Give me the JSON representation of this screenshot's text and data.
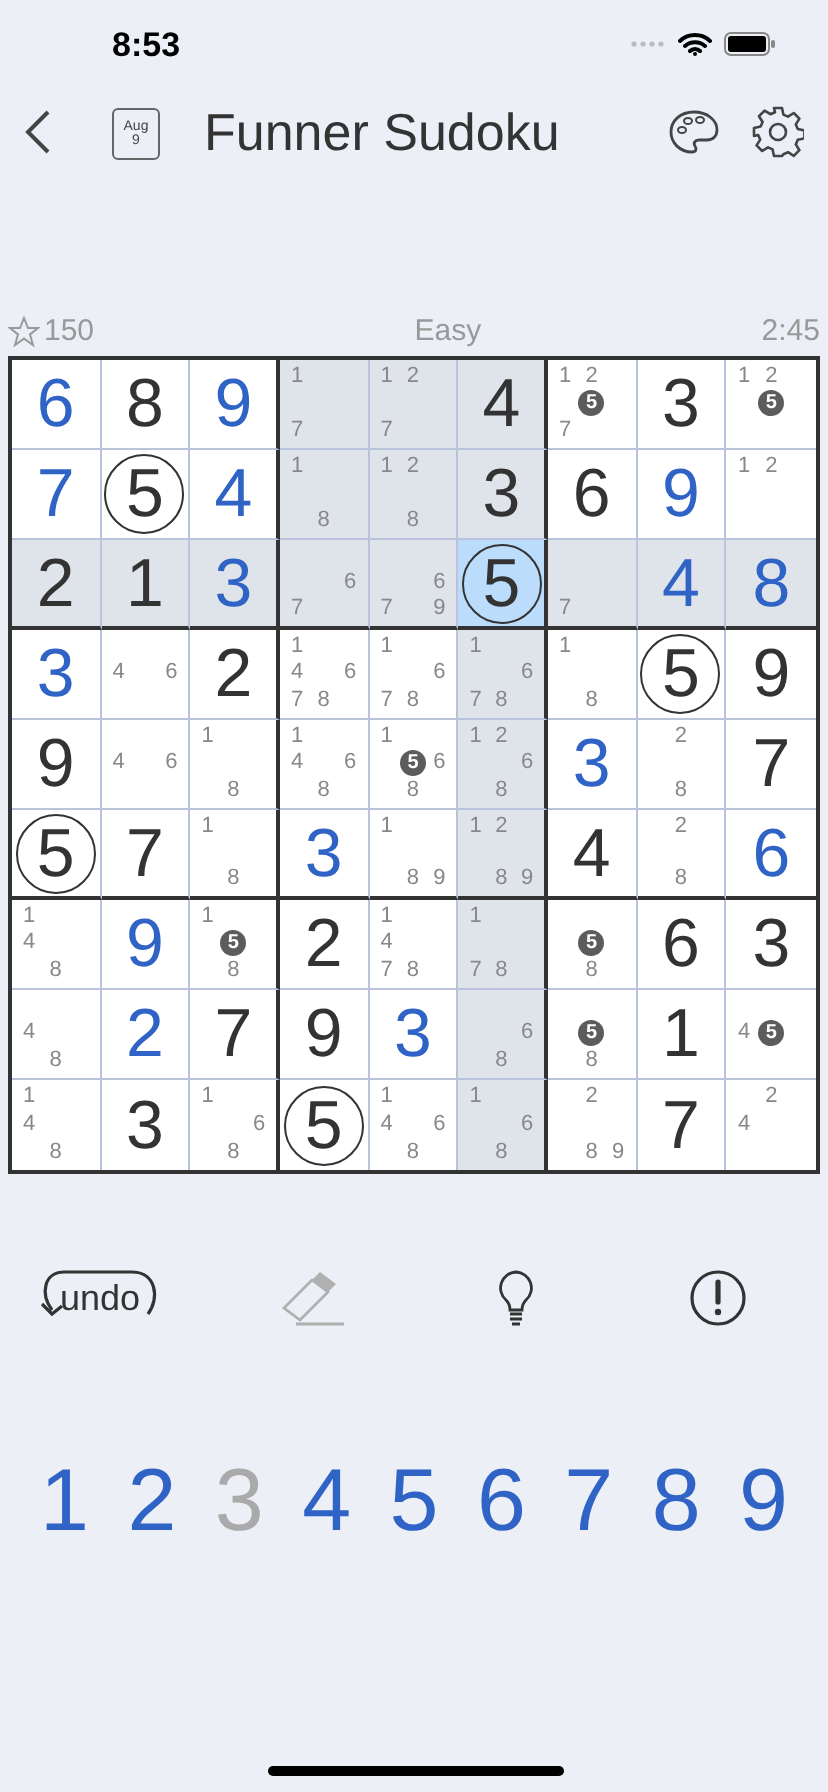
{
  "status_bar": {
    "time": "8:53"
  },
  "nav": {
    "title": "Funner Sudoku",
    "calendar": {
      "month": "Aug",
      "day": "9"
    }
  },
  "info": {
    "stars": "150",
    "difficulty": "Easy",
    "timer": "2:45"
  },
  "grid": [
    [
      {
        "kind": "entered",
        "value": "6",
        "circled": false,
        "highlighted": false,
        "selected": false
      },
      {
        "kind": "given",
        "value": "8",
        "circled": false,
        "highlighted": false,
        "selected": false
      },
      {
        "kind": "entered",
        "value": "9",
        "circled": false,
        "highlighted": false,
        "selected": false
      },
      {
        "kind": "notes",
        "highlighted": true,
        "selected": false,
        "notes": [
          {
            "digit": "1",
            "kind": "topleft",
            "marked": false
          },
          {
            "digit": "7",
            "kind": "bottomleft",
            "marked": false
          }
        ]
      },
      {
        "kind": "notes",
        "highlighted": true,
        "selected": false,
        "notes": [
          {
            "digit": "1",
            "kind": "topleft",
            "marked": false
          },
          {
            "digit": "2",
            "kind": "top",
            "marked": false
          },
          {
            "digit": "7",
            "kind": "bottomleft",
            "marked": false
          }
        ]
      },
      {
        "kind": "given",
        "value": "4",
        "circled": false,
        "highlighted": true,
        "selected": false
      },
      {
        "kind": "notes",
        "highlighted": false,
        "selected": false,
        "notes": [
          {
            "digit": "1",
            "kind": "topleft",
            "marked": false
          },
          {
            "digit": "2",
            "kind": "top",
            "marked": false
          },
          {
            "digit": "5",
            "kind": "center",
            "marked": true
          },
          {
            "digit": "7",
            "kind": "bottomleft",
            "marked": false
          }
        ]
      },
      {
        "kind": "given",
        "value": "3",
        "circled": false,
        "highlighted": false,
        "selected": false
      },
      {
        "kind": "notes",
        "highlighted": false,
        "selected": false,
        "notes": [
          {
            "digit": "1",
            "kind": "topleft",
            "marked": false
          },
          {
            "digit": "2",
            "kind": "top",
            "marked": false
          },
          {
            "digit": "5",
            "kind": "center",
            "marked": true
          }
        ]
      }
    ],
    [
      {
        "kind": "entered",
        "value": "7",
        "circled": false,
        "highlighted": false,
        "selected": false
      },
      {
        "kind": "given",
        "value": "5",
        "circled": true,
        "highlighted": false,
        "selected": false
      },
      {
        "kind": "entered",
        "value": "4",
        "circled": false,
        "highlighted": false,
        "selected": false
      },
      {
        "kind": "notes",
        "highlighted": true,
        "selected": false,
        "notes": [
          {
            "digit": "1",
            "kind": "topleft",
            "marked": false
          },
          {
            "digit": "8",
            "kind": "bottom",
            "marked": false
          }
        ]
      },
      {
        "kind": "notes",
        "highlighted": true,
        "selected": false,
        "notes": [
          {
            "digit": "1",
            "kind": "topleft",
            "marked": false
          },
          {
            "digit": "2",
            "kind": "top",
            "marked": false
          },
          {
            "digit": "8",
            "kind": "bottom",
            "marked": false
          }
        ]
      },
      {
        "kind": "given",
        "value": "3",
        "circled": false,
        "highlighted": true,
        "selected": false
      },
      {
        "kind": "given",
        "value": "6",
        "circled": false,
        "highlighted": false,
        "selected": false
      },
      {
        "kind": "entered",
        "value": "9",
        "circled": false,
        "highlighted": false,
        "selected": false
      },
      {
        "kind": "notes",
        "highlighted": false,
        "selected": false,
        "notes": [
          {
            "digit": "1",
            "kind": "topleft",
            "marked": false
          },
          {
            "digit": "2",
            "kind": "top",
            "marked": false
          }
        ]
      }
    ],
    [
      {
        "kind": "given",
        "value": "2",
        "circled": false,
        "highlighted": true,
        "selected": false
      },
      {
        "kind": "given",
        "value": "1",
        "circled": false,
        "highlighted": true,
        "selected": false
      },
      {
        "kind": "entered",
        "value": "3",
        "circled": false,
        "highlighted": true,
        "selected": false
      },
      {
        "kind": "notes",
        "highlighted": true,
        "selected": false,
        "notes": [
          {
            "digit": "6",
            "kind": "right",
            "marked": false
          },
          {
            "digit": "7",
            "kind": "bottomleft",
            "marked": false
          }
        ]
      },
      {
        "kind": "notes",
        "highlighted": true,
        "selected": false,
        "notes": [
          {
            "digit": "6",
            "kind": "right",
            "marked": false
          },
          {
            "digit": "7",
            "kind": "bottomleft",
            "marked": false
          },
          {
            "digit": "9",
            "kind": "bottomright",
            "marked": false
          }
        ]
      },
      {
        "kind": "given",
        "value": "5",
        "circled": true,
        "selected": true
      },
      {
        "kind": "notes",
        "highlighted": true,
        "selected": false,
        "notes": [
          {
            "digit": "7",
            "kind": "bottomleft",
            "marked": false
          }
        ]
      },
      {
        "kind": "entered",
        "value": "4",
        "circled": false,
        "highlighted": true,
        "selected": false
      },
      {
        "kind": "entered",
        "value": "8",
        "circled": false,
        "highlighted": true,
        "selected": false
      }
    ],
    [
      {
        "kind": "entered",
        "value": "3",
        "circled": false,
        "highlighted": false,
        "selected": false
      },
      {
        "kind": "notes",
        "highlighted": false,
        "selected": false,
        "notes": [
          {
            "digit": "4",
            "kind": "left",
            "marked": false
          },
          {
            "digit": "6",
            "kind": "right",
            "marked": false
          }
        ]
      },
      {
        "kind": "given",
        "value": "2",
        "circled": false,
        "highlighted": false,
        "selected": false
      },
      {
        "kind": "notes",
        "highlighted": false,
        "selected": false,
        "notes": [
          {
            "digit": "1",
            "kind": "topleft",
            "marked": false
          },
          {
            "digit": "4",
            "kind": "left",
            "marked": false
          },
          {
            "digit": "6",
            "kind": "right",
            "marked": false
          },
          {
            "digit": "7",
            "kind": "bottomleft",
            "marked": false
          },
          {
            "digit": "8",
            "kind": "bottom",
            "marked": false
          }
        ]
      },
      {
        "kind": "notes",
        "highlighted": false,
        "selected": false,
        "notes": [
          {
            "digit": "1",
            "kind": "topleft",
            "marked": false
          },
          {
            "digit": "6",
            "kind": "right",
            "marked": false
          },
          {
            "digit": "7",
            "kind": "bottomleft",
            "marked": false
          },
          {
            "digit": "8",
            "kind": "bottom",
            "marked": false
          }
        ]
      },
      {
        "kind": "notes",
        "highlighted": true,
        "selected": false,
        "notes": [
          {
            "digit": "1",
            "kind": "topleft",
            "marked": false
          },
          {
            "digit": "6",
            "kind": "right",
            "marked": false
          },
          {
            "digit": "7",
            "kind": "bottomleft",
            "marked": false
          },
          {
            "digit": "8",
            "kind": "bottom",
            "marked": false
          }
        ]
      },
      {
        "kind": "notes",
        "highlighted": false,
        "selected": false,
        "notes": [
          {
            "digit": "1",
            "kind": "topleft",
            "marked": false
          },
          {
            "digit": "8",
            "kind": "bottom",
            "marked": false
          }
        ]
      },
      {
        "kind": "given",
        "value": "5",
        "circled": true,
        "highlighted": false,
        "selected": false
      },
      {
        "kind": "given",
        "value": "9",
        "circled": false,
        "highlighted": false,
        "selected": false
      }
    ],
    [
      {
        "kind": "given",
        "value": "9",
        "circled": false,
        "highlighted": false,
        "selected": false
      },
      {
        "kind": "notes",
        "highlighted": false,
        "selected": false,
        "notes": [
          {
            "digit": "4",
            "kind": "left",
            "marked": false
          },
          {
            "digit": "6",
            "kind": "right",
            "marked": false
          }
        ]
      },
      {
        "kind": "notes",
        "highlighted": false,
        "selected": false,
        "notes": [
          {
            "digit": "1",
            "kind": "topleft",
            "marked": false
          },
          {
            "digit": "8",
            "kind": "bottom",
            "marked": false
          }
        ]
      },
      {
        "kind": "notes",
        "highlighted": false,
        "selected": false,
        "notes": [
          {
            "digit": "1",
            "kind": "topleft",
            "marked": false
          },
          {
            "digit": "4",
            "kind": "left",
            "marked": false
          },
          {
            "digit": "6",
            "kind": "right",
            "marked": false
          },
          {
            "digit": "8",
            "kind": "bottom",
            "marked": false
          }
        ]
      },
      {
        "kind": "notes",
        "highlighted": false,
        "selected": false,
        "notes": [
          {
            "digit": "1",
            "kind": "topleft",
            "marked": false
          },
          {
            "digit": "5",
            "kind": "center",
            "marked": true
          },
          {
            "digit": "6",
            "kind": "right",
            "marked": false
          },
          {
            "digit": "8",
            "kind": "bottom",
            "marked": false
          }
        ]
      },
      {
        "kind": "notes",
        "highlighted": true,
        "selected": false,
        "notes": [
          {
            "digit": "1",
            "kind": "topleft",
            "marked": false
          },
          {
            "digit": "2",
            "kind": "top",
            "marked": false
          },
          {
            "digit": "6",
            "kind": "right",
            "marked": false
          },
          {
            "digit": "8",
            "kind": "bottom",
            "marked": false
          }
        ]
      },
      {
        "kind": "entered",
        "value": "3",
        "circled": false,
        "highlighted": false,
        "selected": false
      },
      {
        "kind": "notes",
        "highlighted": false,
        "selected": false,
        "notes": [
          {
            "digit": "2",
            "kind": "top",
            "marked": false
          },
          {
            "digit": "8",
            "kind": "bottom",
            "marked": false
          }
        ]
      },
      {
        "kind": "given",
        "value": "7",
        "circled": false,
        "highlighted": false,
        "selected": false
      }
    ],
    [
      {
        "kind": "given",
        "value": "5",
        "circled": true,
        "highlighted": false,
        "selected": false
      },
      {
        "kind": "given",
        "value": "7",
        "circled": false,
        "highlighted": false,
        "selected": false
      },
      {
        "kind": "notes",
        "highlighted": false,
        "selected": false,
        "notes": [
          {
            "digit": "1",
            "kind": "topleft",
            "marked": false
          },
          {
            "digit": "8",
            "kind": "bottom",
            "marked": false
          }
        ]
      },
      {
        "kind": "entered",
        "value": "3",
        "circled": false,
        "highlighted": false,
        "selected": false
      },
      {
        "kind": "notes",
        "highlighted": false,
        "selected": false,
        "notes": [
          {
            "digit": "1",
            "kind": "topleft",
            "marked": false
          },
          {
            "digit": "8",
            "kind": "bottom",
            "marked": false
          },
          {
            "digit": "9",
            "kind": "bottomright",
            "marked": false
          }
        ]
      },
      {
        "kind": "notes",
        "highlighted": true,
        "selected": false,
        "notes": [
          {
            "digit": "1",
            "kind": "topleft",
            "marked": false
          },
          {
            "digit": "2",
            "kind": "top",
            "marked": false
          },
          {
            "digit": "8",
            "kind": "bottom",
            "marked": false
          },
          {
            "digit": "9",
            "kind": "bottomright",
            "marked": false
          }
        ]
      },
      {
        "kind": "given",
        "value": "4",
        "circled": false,
        "highlighted": false,
        "selected": false
      },
      {
        "kind": "notes",
        "highlighted": false,
        "selected": false,
        "notes": [
          {
            "digit": "2",
            "kind": "top",
            "marked": false
          },
          {
            "digit": "8",
            "kind": "bottom",
            "marked": false
          }
        ]
      },
      {
        "kind": "entered",
        "value": "6",
        "circled": false,
        "highlighted": false,
        "selected": false
      }
    ],
    [
      {
        "kind": "notes",
        "highlighted": false,
        "selected": false,
        "notes": [
          {
            "digit": "1",
            "kind": "topleft",
            "marked": false
          },
          {
            "digit": "4",
            "kind": "left",
            "marked": false
          },
          {
            "digit": "8",
            "kind": "bottom",
            "marked": false
          }
        ]
      },
      {
        "kind": "entered",
        "value": "9",
        "circled": false,
        "highlighted": false,
        "selected": false
      },
      {
        "kind": "notes",
        "highlighted": false,
        "selected": false,
        "notes": [
          {
            "digit": "1",
            "kind": "topleft",
            "marked": false
          },
          {
            "digit": "5",
            "kind": "center",
            "marked": true
          },
          {
            "digit": "8",
            "kind": "bottom",
            "marked": false
          }
        ]
      },
      {
        "kind": "given",
        "value": "2",
        "circled": false,
        "highlighted": false,
        "selected": false
      },
      {
        "kind": "notes",
        "highlighted": false,
        "selected": false,
        "notes": [
          {
            "digit": "1",
            "kind": "topleft",
            "marked": false
          },
          {
            "digit": "4",
            "kind": "left",
            "marked": false
          },
          {
            "digit": "7",
            "kind": "bottomleft",
            "marked": false
          },
          {
            "digit": "8",
            "kind": "bottom",
            "marked": false
          }
        ]
      },
      {
        "kind": "notes",
        "highlighted": true,
        "selected": false,
        "notes": [
          {
            "digit": "1",
            "kind": "topleft",
            "marked": false
          },
          {
            "digit": "7",
            "kind": "bottomleft",
            "marked": false
          },
          {
            "digit": "8",
            "kind": "bottom",
            "marked": false
          }
        ]
      },
      {
        "kind": "notes",
        "highlighted": false,
        "selected": false,
        "notes": [
          {
            "digit": "5",
            "kind": "center",
            "marked": true
          },
          {
            "digit": "8",
            "kind": "bottom",
            "marked": false
          }
        ]
      },
      {
        "kind": "given",
        "value": "6",
        "circled": false,
        "highlighted": false,
        "selected": false
      },
      {
        "kind": "given",
        "value": "3",
        "circled": false,
        "highlighted": false,
        "selected": false
      }
    ],
    [
      {
        "kind": "notes",
        "highlighted": false,
        "selected": false,
        "notes": [
          {
            "digit": "4",
            "kind": "left",
            "marked": false
          },
          {
            "digit": "8",
            "kind": "bottom",
            "marked": false
          }
        ]
      },
      {
        "kind": "entered",
        "value": "2",
        "circled": false,
        "highlighted": false,
        "selected": false
      },
      {
        "kind": "given",
        "value": "7",
        "circled": false,
        "highlighted": false,
        "selected": false
      },
      {
        "kind": "given",
        "value": "9",
        "circled": false,
        "highlighted": false,
        "selected": false
      },
      {
        "kind": "entered",
        "value": "3",
        "circled": false,
        "highlighted": false,
        "selected": false
      },
      {
        "kind": "notes",
        "highlighted": true,
        "selected": false,
        "notes": [
          {
            "digit": "6",
            "kind": "right",
            "marked": false
          },
          {
            "digit": "8",
            "kind": "bottom",
            "marked": false
          }
        ]
      },
      {
        "kind": "notes",
        "highlighted": false,
        "selected": false,
        "notes": [
          {
            "digit": "5",
            "kind": "center",
            "marked": true
          },
          {
            "digit": "8",
            "kind": "bottom",
            "marked": false
          }
        ]
      },
      {
        "kind": "given",
        "value": "1",
        "circled": false,
        "highlighted": false,
        "selected": false
      },
      {
        "kind": "notes",
        "highlighted": false,
        "selected": false,
        "notes": [
          {
            "digit": "4",
            "kind": "left",
            "marked": false
          },
          {
            "digit": "5",
            "kind": "center",
            "marked": true
          }
        ]
      }
    ],
    [
      {
        "kind": "notes",
        "highlighted": false,
        "selected": false,
        "notes": [
          {
            "digit": "1",
            "kind": "topleft",
            "marked": false
          },
          {
            "digit": "4",
            "kind": "left",
            "marked": false
          },
          {
            "digit": "8",
            "kind": "bottom",
            "marked": false
          }
        ]
      },
      {
        "kind": "given",
        "value": "3",
        "circled": false,
        "highlighted": false,
        "selected": false
      },
      {
        "kind": "notes",
        "highlighted": false,
        "selected": false,
        "notes": [
          {
            "digit": "1",
            "kind": "topleft",
            "marked": false
          },
          {
            "digit": "6",
            "kind": "right",
            "marked": false
          },
          {
            "digit": "8",
            "kind": "bottom",
            "marked": false
          }
        ]
      },
      {
        "kind": "given",
        "value": "5",
        "circled": true,
        "highlighted": false,
        "selected": false
      },
      {
        "kind": "notes",
        "highlighted": false,
        "selected": false,
        "notes": [
          {
            "digit": "1",
            "kind": "topleft",
            "marked": false
          },
          {
            "digit": "4",
            "kind": "left",
            "marked": false
          },
          {
            "digit": "6",
            "kind": "right",
            "marked": false
          },
          {
            "digit": "8",
            "kind": "bottom",
            "marked": false
          }
        ]
      },
      {
        "kind": "notes",
        "highlighted": true,
        "selected": false,
        "notes": [
          {
            "digit": "1",
            "kind": "topleft",
            "marked": false
          },
          {
            "digit": "6",
            "kind": "right",
            "marked": false
          },
          {
            "digit": "8",
            "kind": "bottom",
            "marked": false
          }
        ]
      },
      {
        "kind": "notes",
        "highlighted": false,
        "selected": false,
        "notes": [
          {
            "digit": "2",
            "kind": "top",
            "marked": false
          },
          {
            "digit": "8",
            "kind": "bottom",
            "marked": false
          },
          {
            "digit": "9",
            "kind": "bottomright",
            "marked": false
          }
        ]
      },
      {
        "kind": "given",
        "value": "7",
        "circled": false,
        "highlighted": false,
        "selected": false
      },
      {
        "kind": "notes",
        "highlighted": false,
        "selected": false,
        "notes": [
          {
            "digit": "2",
            "kind": "top",
            "marked": false
          },
          {
            "digit": "4",
            "kind": "left",
            "marked": false
          }
        ]
      }
    ]
  ],
  "tools": [
    {
      "kind": "undo",
      "label": "undo",
      "disabled": false
    },
    {
      "kind": "erase",
      "disabled": true
    },
    {
      "kind": "hint",
      "disabled": false
    },
    {
      "kind": "check",
      "disabled": false
    }
  ],
  "number_pad": [
    {
      "digit": "1",
      "disabled": false
    },
    {
      "digit": "2",
      "disabled": false
    },
    {
      "digit": "3",
      "disabled": true
    },
    {
      "digit": "4",
      "disabled": false
    },
    {
      "digit": "5",
      "disabled": false
    },
    {
      "digit": "6",
      "disabled": false
    },
    {
      "digit": "7",
      "disabled": false
    },
    {
      "digit": "8",
      "disabled": false
    },
    {
      "digit": "9",
      "disabled": false
    }
  ]
}
